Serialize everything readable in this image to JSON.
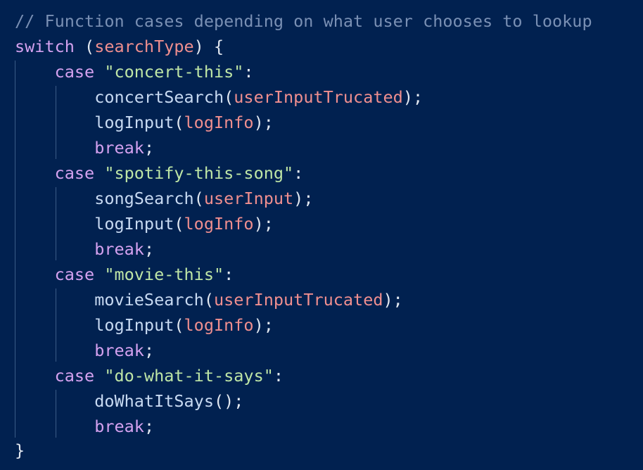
{
  "theme": {
    "background": "#012150",
    "comment": "#7a90b4",
    "keyword": "#d5a2f0",
    "string": "#bfe6a6",
    "variable": "#f08f8f",
    "function": "#c8daf2",
    "punctuation": "#e2e8f0",
    "indent_guide": "#3a5b86"
  },
  "code": {
    "comment": "// Function cases depending on what user chooses to lookup",
    "switch_keyword": "switch",
    "switch_open": " (",
    "switch_var": "searchType",
    "switch_close": ") {",
    "cases": [
      {
        "keyword": "case",
        "label": "\"concert-this\"",
        "colon": ":",
        "calls": [
          {
            "fn": "concertSearch",
            "open": "(",
            "arg": "userInputTrucated",
            "close": ");"
          },
          {
            "fn": "logInput",
            "open": "(",
            "arg": "logInfo",
            "close": ");"
          }
        ],
        "break_kw": "break",
        "break_end": ";"
      },
      {
        "keyword": "case",
        "label": "\"spotify-this-song\"",
        "colon": ":",
        "calls": [
          {
            "fn": "songSearch",
            "open": "(",
            "arg": "userInput",
            "close": ");"
          },
          {
            "fn": "logInput",
            "open": "(",
            "arg": "logInfo",
            "close": ");"
          }
        ],
        "break_kw": "break",
        "break_end": ";"
      },
      {
        "keyword": "case",
        "label": "\"movie-this\"",
        "colon": ":",
        "calls": [
          {
            "fn": "movieSearch",
            "open": "(",
            "arg": "userInputTrucated",
            "close": ");"
          },
          {
            "fn": "logInput",
            "open": "(",
            "arg": "logInfo",
            "close": ");"
          }
        ],
        "break_kw": "break",
        "break_end": ";"
      },
      {
        "keyword": "case",
        "label": "\"do-what-it-says\"",
        "colon": ":",
        "calls": [
          {
            "fn": "doWhatItSays",
            "open": "(",
            "arg": "",
            "close": ");"
          }
        ],
        "break_kw": "break",
        "break_end": ";"
      }
    ],
    "closing_brace": "}"
  }
}
